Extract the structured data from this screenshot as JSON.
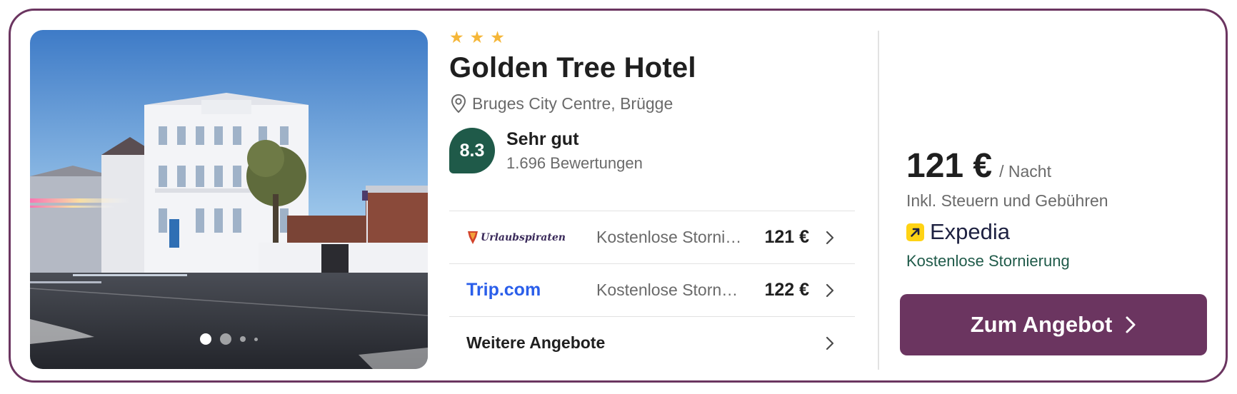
{
  "hotel": {
    "stars": 3,
    "name": "Golden Tree Hotel",
    "location": "Bruges City Centre, Brügge",
    "rating_score": "8.3",
    "rating_label": "Sehr gut",
    "rating_count": "1.696 Bewertungen",
    "photo_dots": 4,
    "photo_active_index": 0
  },
  "offers": [
    {
      "provider": "Urlaubspiraten",
      "provider_icon": "pirate-flag-icon",
      "description": "Kostenlose Storni…",
      "price": "121 €"
    },
    {
      "provider": "Trip.com",
      "description": "Kostenlose Storn…",
      "price": "122 €"
    }
  ],
  "more_offers_label": "Weitere Angebote",
  "best_offer": {
    "price": "121 €",
    "per_night": "/ Nacht",
    "taxes_note": "Inkl. Steuern und Gebühren",
    "provider": "Expedia",
    "provider_icon": "expedia-arrow-icon",
    "cancellation": "Kostenlose Stornierung",
    "cta_label": "Zum Angebot"
  },
  "colors": {
    "brand": "#6b3560",
    "rating_badge": "#1f5a49",
    "star": "#f5b638",
    "tripcom": "#2a5eea",
    "expedia_yellow": "#ffd314"
  }
}
